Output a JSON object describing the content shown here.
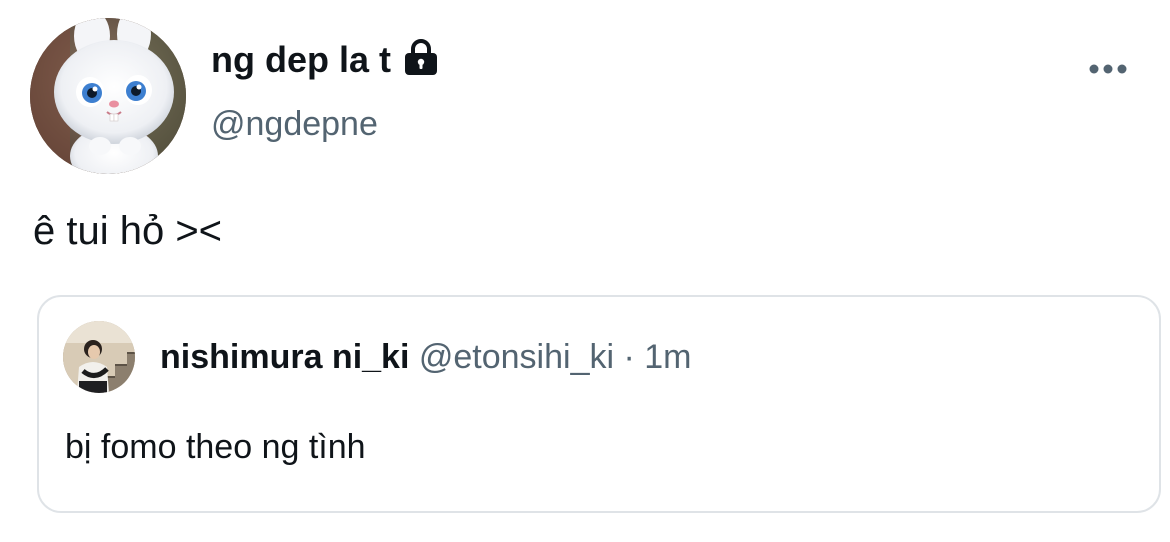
{
  "tweet": {
    "display_name": "ng dep la t",
    "username": "@ngdepne",
    "text": "ê tui hỏ ><",
    "author_avatar_icon": "bunny-avatar-icon",
    "protected_icon": "lock-icon",
    "more_icon": "more-options-icon"
  },
  "quote": {
    "display_name": "nishimura ni_ki",
    "username": "@etonsihi_ki",
    "separator": "·",
    "timestamp": "1m",
    "text": "bị fomo theo ng tình",
    "avatar_icon": "person-avatar-icon"
  },
  "colors": {
    "primary_text": "#0f1419",
    "secondary_text": "#536471",
    "border": "#dfe3e7",
    "background": "#ffffff"
  }
}
